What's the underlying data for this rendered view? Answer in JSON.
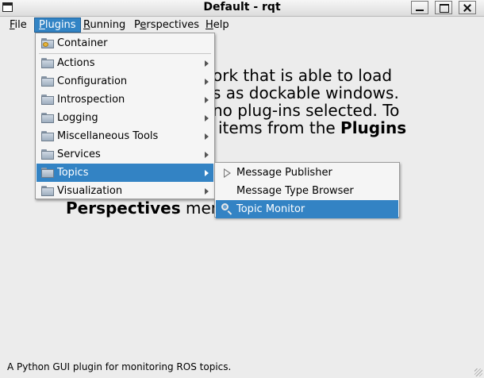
{
  "window": {
    "title": "Default - rqt"
  },
  "menubar": {
    "items": [
      {
        "label": "File",
        "mnemonic": "F",
        "rest": "ile"
      },
      {
        "label": "Plugins",
        "mnemonic": "P",
        "rest": "lugins"
      },
      {
        "label": "Running",
        "mnemonic": "R",
        "rest": "unning"
      },
      {
        "label": "Perspectives",
        "pre": "P",
        "mnemonic": "e",
        "rest": "rspectives"
      },
      {
        "label": "Help",
        "mnemonic": "H",
        "rest": "elp"
      }
    ]
  },
  "background_text": {
    "line1": "ork that is able to load",
    "line2": "s as dockable windows.",
    "line3": "no plug-ins selected. To",
    "line4_pre": "items from the ",
    "line4_bold": "Plugins",
    "line5_bold": "Perspectives",
    "line5_rest": " men"
  },
  "plugins_menu": {
    "items": [
      {
        "label": "Container"
      },
      {
        "label": "Actions"
      },
      {
        "label": "Configuration"
      },
      {
        "label": "Introspection"
      },
      {
        "label": "Logging"
      },
      {
        "label": "Miscellaneous Tools"
      },
      {
        "label": "Services"
      },
      {
        "label": "Topics"
      },
      {
        "label": "Visualization"
      }
    ]
  },
  "topics_menu": {
    "items": [
      {
        "label": "Message Publisher"
      },
      {
        "label": "Message Type Browser"
      },
      {
        "label": "Topic Monitor"
      }
    ]
  },
  "status_bar": {
    "text": "A Python GUI plugin for monitoring ROS topics."
  },
  "colors": {
    "highlight": "#3383c4",
    "background": "#ececec"
  }
}
